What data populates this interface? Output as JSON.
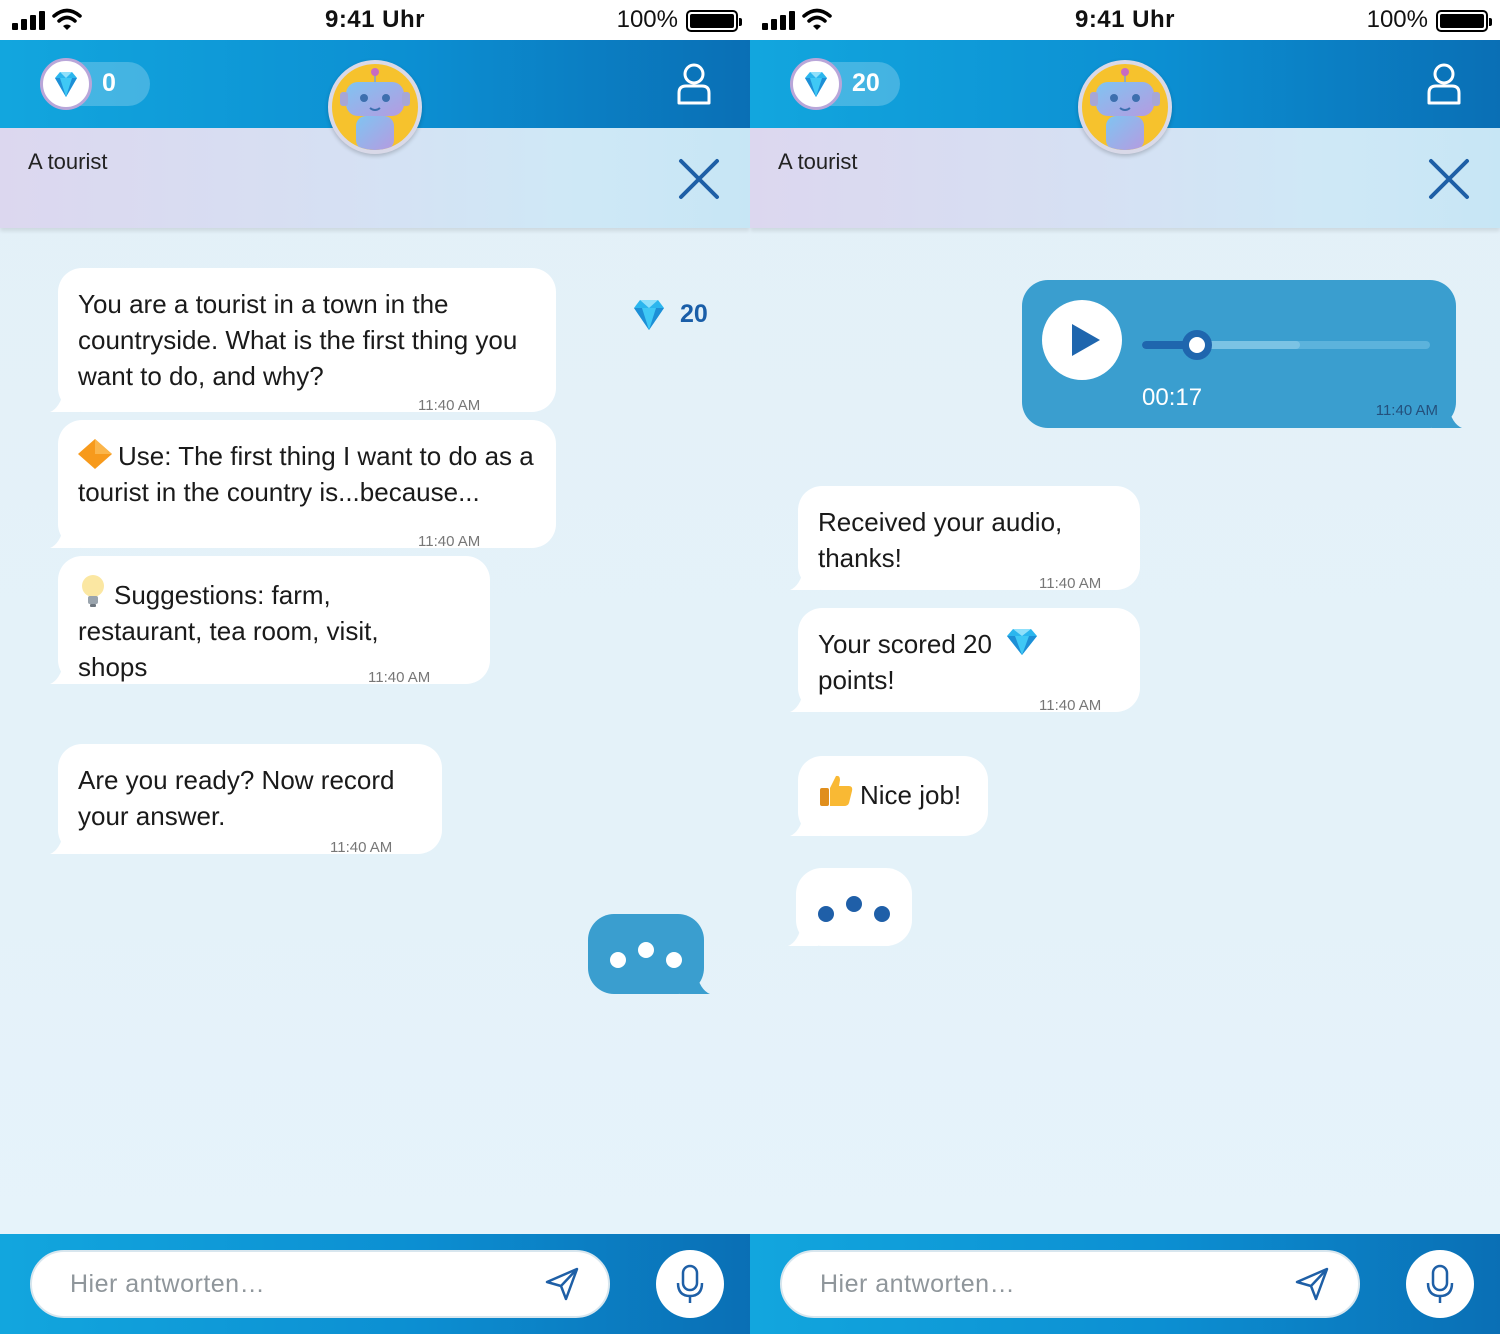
{
  "status_bar": {
    "time": "9:41 Uhr",
    "battery": "100%"
  },
  "left": {
    "score": "0",
    "topic": "A tourist",
    "reward": "20",
    "messages": [
      {
        "text": "You are a tourist in a town in the countryside. What is the first thing you want to do, and why?",
        "time": "11:40 AM"
      },
      {
        "text": "Use: The first thing I want to do as a tourist in the country is...because...",
        "time": "11:40 AM"
      },
      {
        "text": "Suggestions: farm, restaurant, tea room, visit, shops",
        "time": "11:40 AM"
      },
      {
        "text": "Are you ready? Now record your answer.",
        "time": "11:40 AM"
      }
    ],
    "input_placeholder": "Hier antworten…"
  },
  "right": {
    "score": "20",
    "topic": "A tourist",
    "audio": {
      "duration": "00:17",
      "time": "11:40 AM",
      "progress": 0.19,
      "buffered": 0.55
    },
    "messages": [
      {
        "text": "Received your audio, thanks!",
        "time": "11:40 AM"
      },
      {
        "text": "Your scored 20",
        "text2": "points!",
        "time": "11:40 AM"
      },
      {
        "text": "Nice job!"
      }
    ],
    "input_placeholder": "Hier antworten…"
  },
  "colors": {
    "header_blue": "#0c8fd2",
    "bubble_blue": "#3a9ecf",
    "dark_blue": "#1f66ae",
    "gem": "#2bb6ee"
  }
}
